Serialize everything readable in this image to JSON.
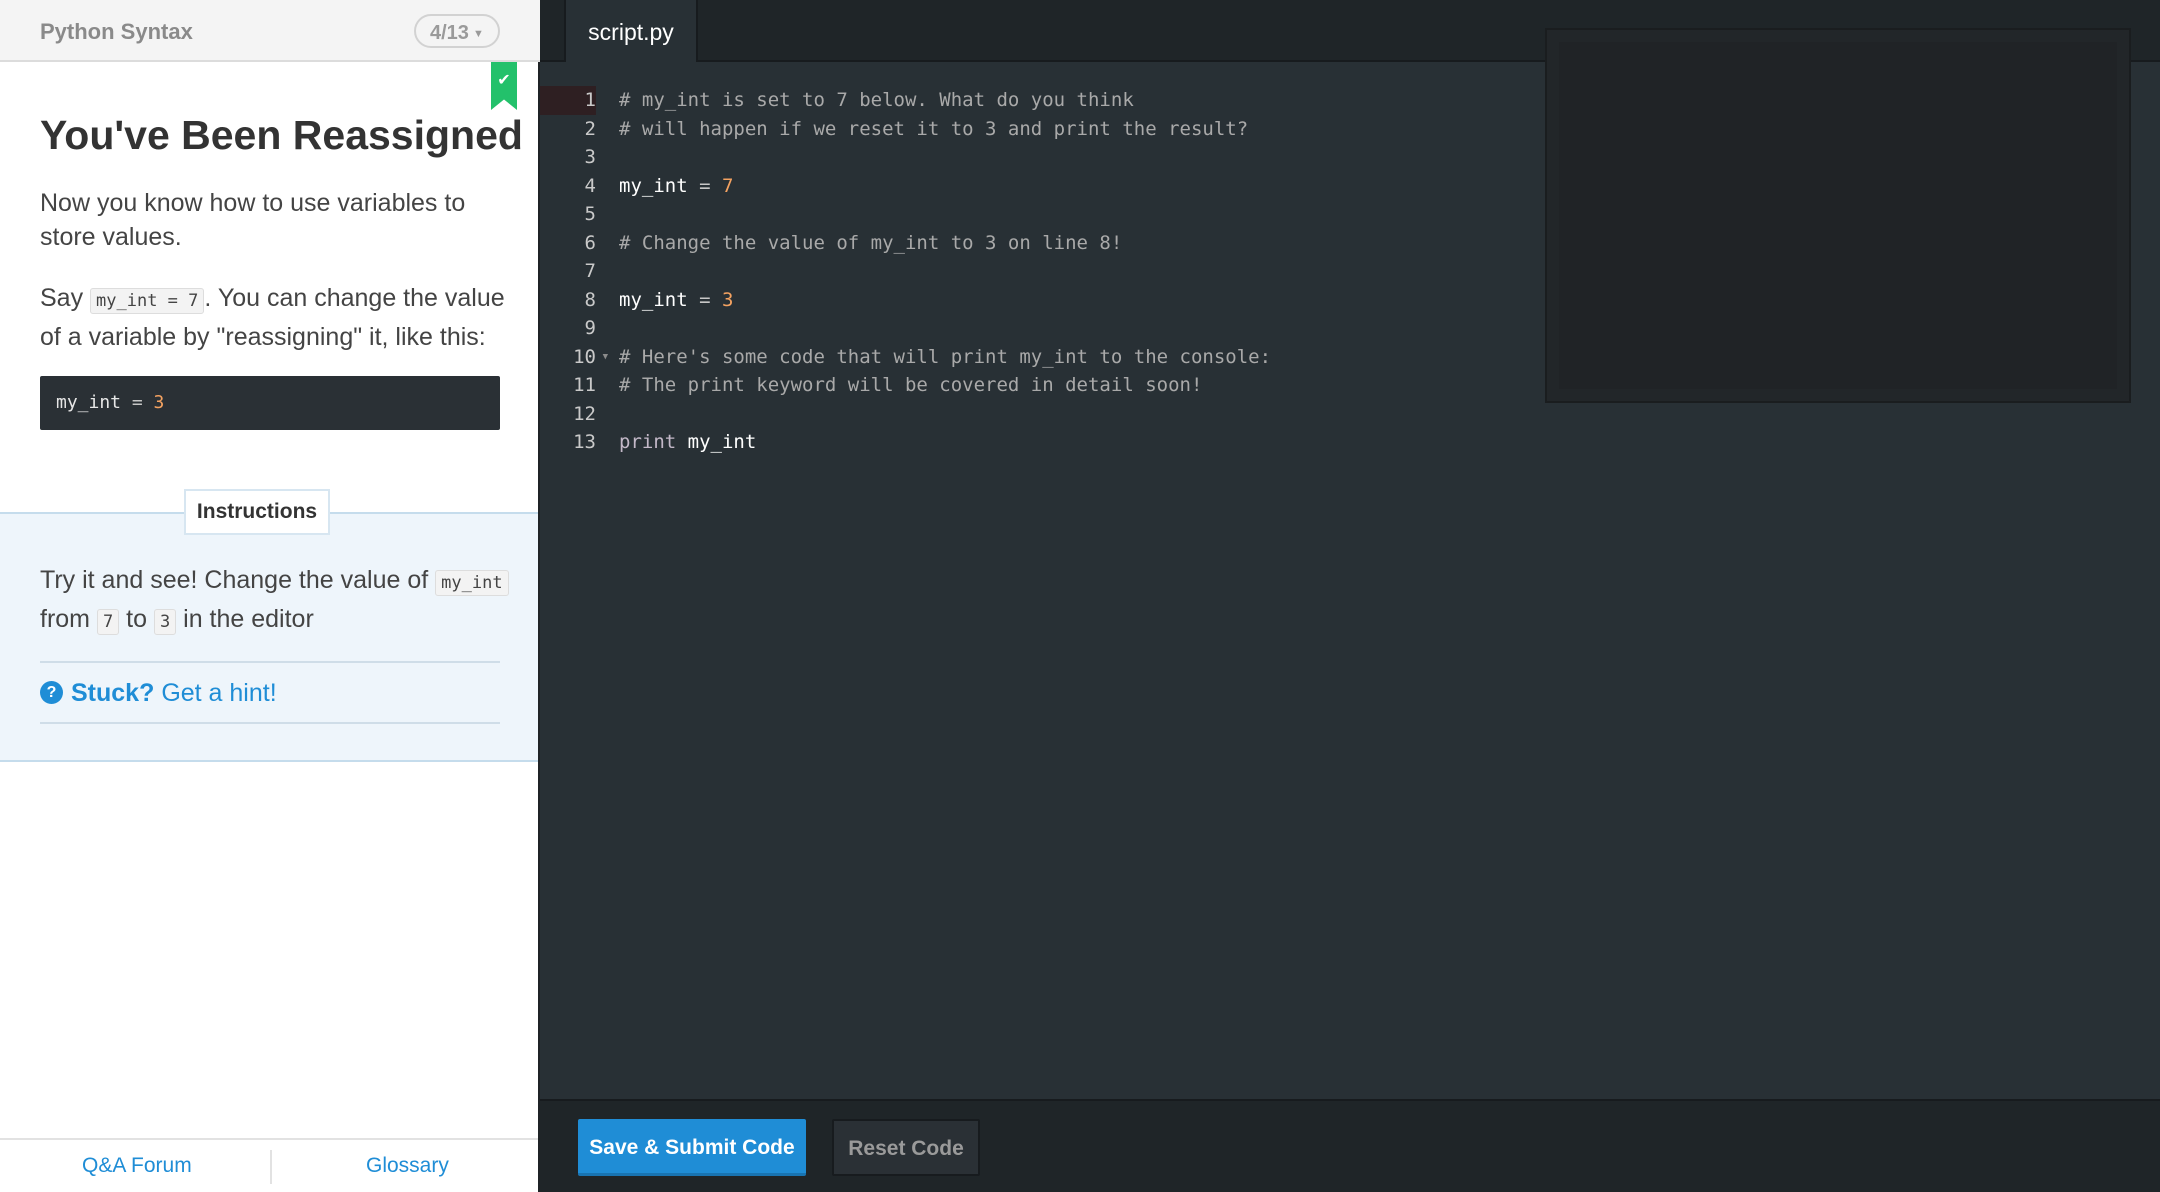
{
  "header": {
    "course_title": "Python Syntax",
    "progress": "4/13"
  },
  "lesson": {
    "title": "You've Been Reassigned",
    "p1": "Now you know how to use variables to store values.",
    "p2_before": "Say ",
    "p2_code": "my_int = 7",
    "p2_after": ". You can change the value of a variable by \"reassigning\" it, like this:",
    "code_example": {
      "var": "my_int",
      "op": " = ",
      "value": "3"
    }
  },
  "instructions": {
    "label": "Instructions",
    "text_1": "Try it and see! Change the value of ",
    "code_1": "my_int",
    "text_2": "from ",
    "code_2": "7",
    "text_3": " to ",
    "code_3": "3",
    "text_4": " in the editor",
    "stuck_label": "Stuck?",
    "hint_label": "Get a hint!"
  },
  "footer": {
    "qa_label": "Q&A Forum",
    "glossary_label": "Glossary"
  },
  "editor": {
    "tab_label": "script.py",
    "line_numbers": [
      "1",
      "2",
      "3",
      "4",
      "5",
      "6",
      "7",
      "8",
      "9",
      "10",
      "11",
      "12",
      "13"
    ],
    "lines": [
      "# my_int is set to 7 below. What do you think",
      "# will happen if we reset it to 3 and print the result?",
      "",
      "my_int = 7",
      "",
      "# Change the value of my_int to 3 on line 8!",
      "",
      "my_int = 3",
      "",
      "# Here's some code that will print my_int to the console:",
      "# The print keyword will be covered in detail soon!",
      "",
      "print my_int"
    ],
    "submit_label": "Save & Submit Code",
    "reset_label": "Reset Code"
  },
  "colors": {
    "accent": "#1f8dd6",
    "bookmark": "#23c16b",
    "editor_bg": "#283035",
    "number": "#f4a261"
  }
}
